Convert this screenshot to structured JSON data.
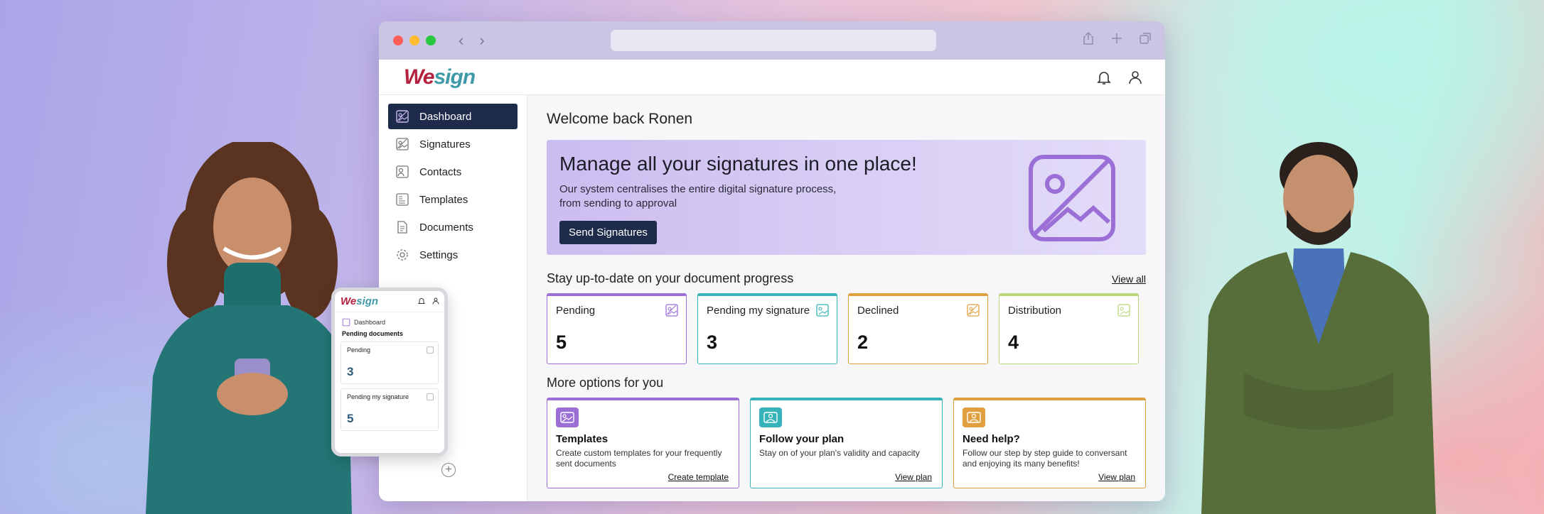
{
  "colors": {
    "navy": "#1e2b4a",
    "brand_red": "#b5223f",
    "brand_teal": "#3f9aa8",
    "purple": "#9b6fd6",
    "teal": "#35b3b8",
    "orange": "#e0a040",
    "green": "#b7d77a"
  },
  "browser": {
    "traffic_lights": [
      "#ff5f57",
      "#febc2e",
      "#28c840"
    ],
    "toolbar_icons": [
      "share-icon",
      "new-tab-icon",
      "tabs-icon"
    ]
  },
  "header": {
    "logo_we": "We",
    "logo_sign": "sign",
    "icons": [
      "bell-icon",
      "user-icon"
    ]
  },
  "sidebar": {
    "items": [
      {
        "label": "Dashboard",
        "icon": "image-icon",
        "active": true
      },
      {
        "label": "Signatures",
        "icon": "image-icon"
      },
      {
        "label": "Contacts",
        "icon": "contact-icon"
      },
      {
        "label": "Templates",
        "icon": "template-icon"
      },
      {
        "label": "Documents",
        "icon": "document-icon"
      },
      {
        "label": "Settings",
        "icon": "gear-icon"
      }
    ]
  },
  "main": {
    "welcome": "Welcome back Ronen",
    "hero": {
      "title": "Manage all your signatures in one place!",
      "text": "Our system centralises the entire digital signature process, from sending to approval",
      "button": "Send Signatures"
    },
    "progress": {
      "title": "Stay up-to-date on your document progress",
      "view_all": "View all",
      "cards": [
        {
          "label": "Pending",
          "value": "5",
          "color": "#9b6fd6"
        },
        {
          "label": "Pending my signature",
          "value": "3",
          "color": "#35b3b8"
        },
        {
          "label": "Declined",
          "value": "2",
          "color": "#e0a040"
        },
        {
          "label": "Distribution",
          "value": "4",
          "color": "#b7d77a"
        }
      ]
    },
    "options": {
      "title": "More options for you",
      "cards": [
        {
          "title": "Templates",
          "text": "Create custom templates for your frequently sent documents",
          "link": "Create template",
          "color": "#9b6fd6"
        },
        {
          "title": "Follow your plan",
          "text": "Stay on of your plan's validity and capacity",
          "link": "View plan",
          "color": "#35b3b8"
        },
        {
          "title": "Need help?",
          "text": "Follow our step by step guide to conversant and enjoying its many benefits!",
          "link": "View plan",
          "color": "#e0a040"
        }
      ]
    }
  },
  "mobile": {
    "logo_we": "We",
    "logo_sign": "sign",
    "nav": "Dashboard",
    "subtitle": "Pending documents",
    "cards": [
      {
        "label": "Pending",
        "value": "3"
      },
      {
        "label": "Pending my signature",
        "value": "5"
      }
    ]
  }
}
